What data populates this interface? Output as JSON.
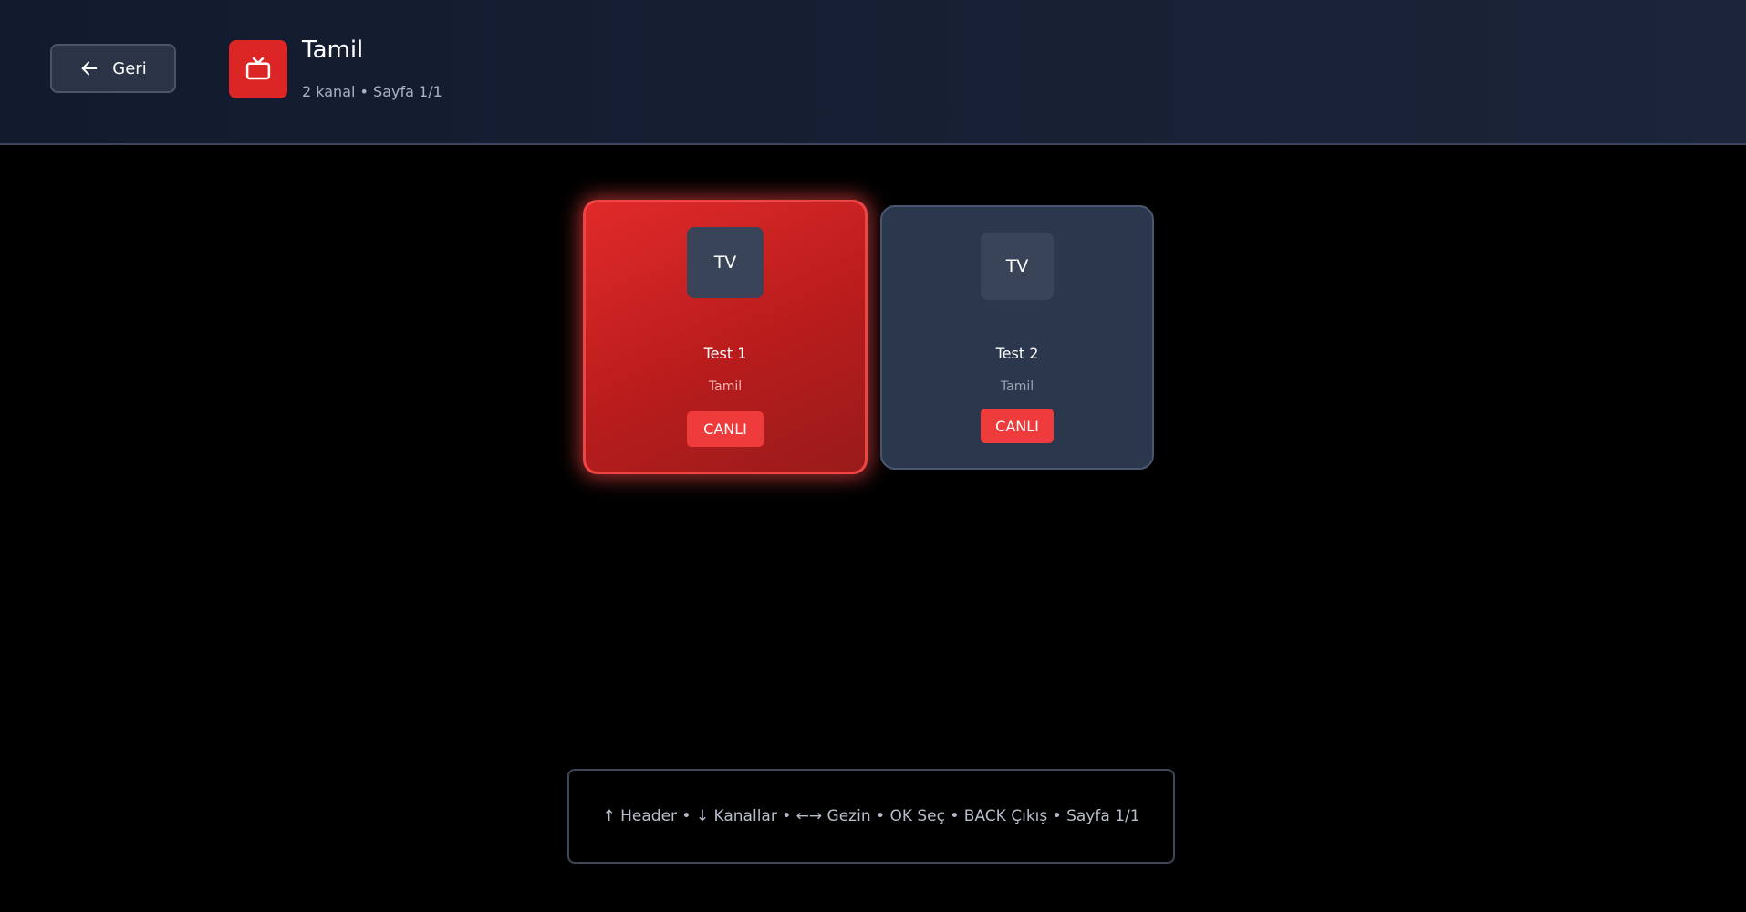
{
  "header": {
    "back_label": "Geri",
    "category_icon": "tv-icon",
    "title": "Tamil",
    "subtitle": "2 kanal • Sayfa 1/1"
  },
  "channels": [
    {
      "thumb_label": "TV",
      "name": "Test 1",
      "category": "Tamil",
      "badge": "CANLI",
      "focused": true
    },
    {
      "thumb_label": "TV",
      "name": "Test 2",
      "category": "Tamil",
      "badge": "CANLI",
      "focused": false
    }
  ],
  "help": {
    "text": "↑ Header • ↓ Kanallar • ←→ Gezin • OK Seç • BACK Çıkış • Sayfa 1/1"
  },
  "colors": {
    "accent": "#dc2626",
    "live_badge": "#ef3b3b",
    "header_bg": "#121a2e",
    "card_bg": "#2b374c"
  }
}
